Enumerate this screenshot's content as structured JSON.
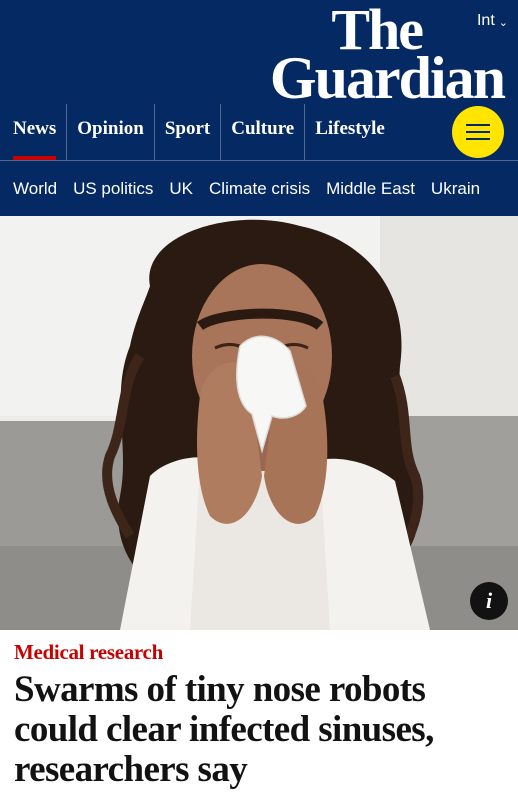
{
  "header": {
    "edition": "Int",
    "logo_line1": "The",
    "logo_line2": "Guardian",
    "pillars": [
      {
        "label": "News",
        "active": true
      },
      {
        "label": "Opinion",
        "active": false
      },
      {
        "label": "Sport",
        "active": false
      },
      {
        "label": "Culture",
        "active": false
      },
      {
        "label": "Lifestyle",
        "active": false
      }
    ],
    "menu_icon": "hamburger-icon"
  },
  "subnav": {
    "items": [
      "World",
      "US politics",
      "UK",
      "Climate crisis",
      "Middle East",
      "Ukrain"
    ]
  },
  "hero": {
    "info_label": "i"
  },
  "article": {
    "kicker": "Medical research",
    "headline": "Swarms of tiny nose robots could clear infected sinuses, researchers say"
  },
  "colors": {
    "brand_blue": "#052962",
    "accent_yellow": "#ffe500",
    "news_red": "#c70000"
  }
}
